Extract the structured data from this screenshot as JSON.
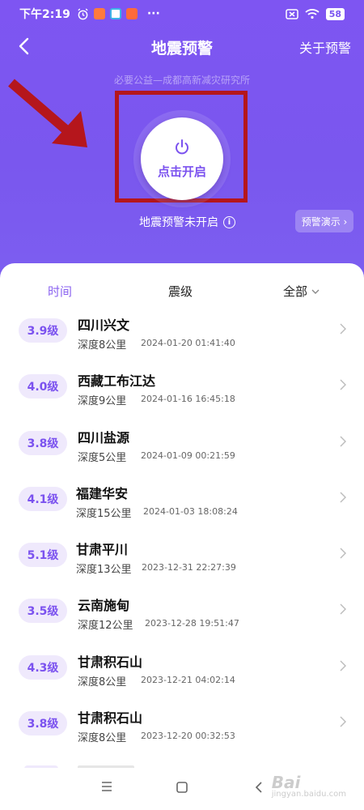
{
  "status_bar": {
    "time": "下午2:19",
    "dots": "···",
    "battery": "58"
  },
  "nav": {
    "title": "地震预警",
    "about": "关于预警"
  },
  "subtitle": "必要公益—成都高新减灾研究所",
  "power": {
    "label": "点击开启"
  },
  "warning_status": "地震预警未开启",
  "demo_button": "预警演示 ›",
  "tabs": {
    "time": "时间",
    "magnitude": "震级",
    "all": "全部"
  },
  "earthquakes": [
    {
      "mag": "3.9级",
      "place": "四川兴文",
      "depth": "深度8公里",
      "time": "2024-01-20 01:41:40"
    },
    {
      "mag": "4.0级",
      "place": "西藏工布江达",
      "depth": "深度9公里",
      "time": "2024-01-16 16:45:18"
    },
    {
      "mag": "3.8级",
      "place": "四川盐源",
      "depth": "深度5公里",
      "time": "2024-01-09 00:21:59"
    },
    {
      "mag": "4.1级",
      "place": "福建华安",
      "depth": "深度15公里",
      "time": "2024-01-03 18:08:24"
    },
    {
      "mag": "5.1级",
      "place": "甘肃平川",
      "depth": "深度13公里",
      "time": "2023-12-31 22:27:39"
    },
    {
      "mag": "3.5级",
      "place": "云南施甸",
      "depth": "深度12公里",
      "time": "2023-12-28 19:51:47"
    },
    {
      "mag": "4.3级",
      "place": "甘肃积石山",
      "depth": "深度8公里",
      "time": "2023-12-21 04:02:14"
    },
    {
      "mag": "3.8级",
      "place": "甘肃积石山",
      "depth": "深度8公里",
      "time": "2023-12-20 00:32:53"
    }
  ],
  "watermark": {
    "main": "Bai",
    "sub": "jingyan.baidu.com"
  },
  "colors": {
    "accent": "#7b56f0",
    "highlight_box": "#b5161c",
    "badge_bg": "#efe9fc"
  },
  "icons": [
    "back-icon",
    "power-icon",
    "info-icon",
    "chevron-down-icon",
    "chevron-right-icon",
    "menu-icon",
    "home-icon",
    "back-nav-icon"
  ]
}
